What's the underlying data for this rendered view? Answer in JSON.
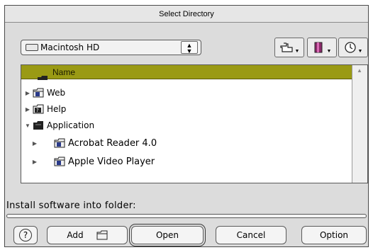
{
  "window": {
    "title": "Select Directory"
  },
  "volume": {
    "label": "Macintosh HD"
  },
  "toolbar": {
    "icons": [
      "shortcuts-icon",
      "favorites-icon",
      "recent-icon"
    ]
  },
  "list": {
    "header": "Name",
    "items": [
      {
        "label": "Web",
        "icon": "folder-icon",
        "expanded": false
      },
      {
        "label": "Help",
        "icon": "help-folder-icon",
        "expanded": false
      },
      {
        "label": "Application",
        "icon": "folder-icon",
        "expanded": true
      },
      {
        "label": "Acrobat Reader 4.0",
        "icon": "folder-icon",
        "expanded": false
      },
      {
        "label": "Apple Video Player",
        "icon": "folder-icon",
        "expanded": false
      }
    ]
  },
  "prompt": "Install software into folder:",
  "buttons": {
    "help": "?",
    "add": "Add",
    "open": "Open",
    "cancel": "Cancel",
    "option": "Option"
  },
  "colors": {
    "header": "#9a9a14",
    "window": "#dcdcdc"
  }
}
